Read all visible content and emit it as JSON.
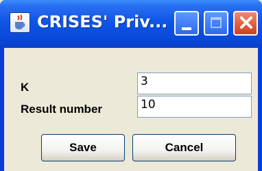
{
  "window": {
    "title": "CRISES' Priv...",
    "icon": "java-cup-icon"
  },
  "form": {
    "k_label": "K",
    "k_value": "3",
    "result_label": "Result number",
    "result_value": "10"
  },
  "buttons": {
    "save_label": "Save",
    "cancel_label": "Cancel"
  },
  "colors": {
    "titlebar": "#0a49d9",
    "close_button": "#d0401b",
    "background": "#ece9d8"
  }
}
